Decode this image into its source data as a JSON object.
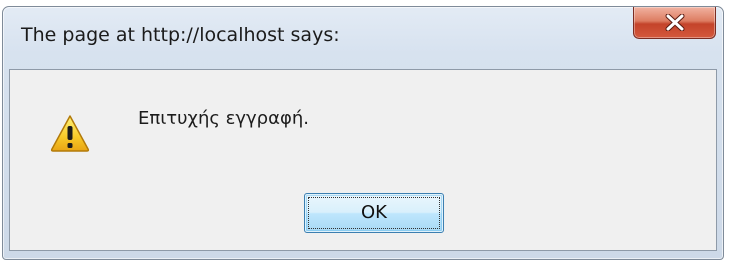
{
  "dialog": {
    "title": "The page at http://localhost says:",
    "message": "Επιτυχής εγγραφή.",
    "ok_label": "OK",
    "icon": "warning-icon",
    "close_icon": "close-icon"
  },
  "colors": {
    "close_button": "#c4432a",
    "ok_button_border": "#3c7fb1",
    "client_background": "#f0f0f0",
    "warning_yellow": "#f5c518"
  }
}
